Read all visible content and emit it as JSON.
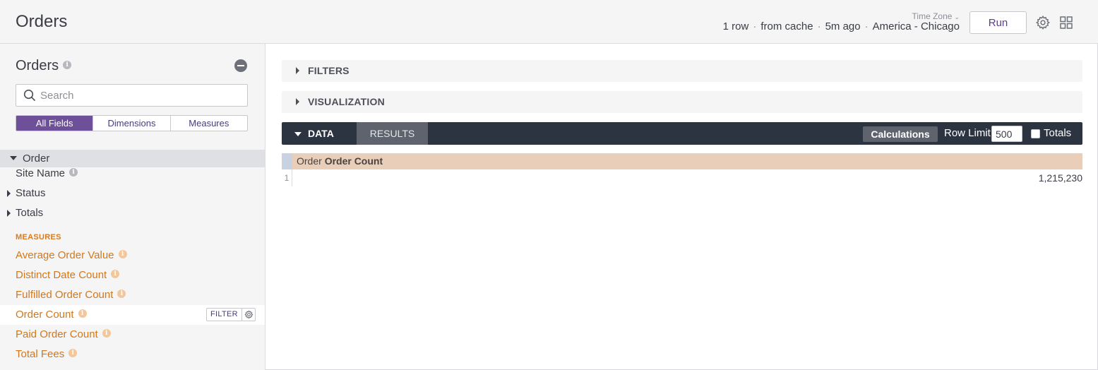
{
  "header": {
    "title": "Orders",
    "time_zone_label": "Time Zone",
    "meta": [
      "1 row",
      "from cache",
      "5m ago",
      "America - Chicago"
    ],
    "run_label": "Run"
  },
  "sidebar": {
    "explore_title": "Orders",
    "search_placeholder": "Search",
    "tabs": [
      "All Fields",
      "Dimensions",
      "Measures"
    ],
    "active_tab": "All Fields",
    "view_label": "Order",
    "dimensions": [
      {
        "label": "Site Name",
        "has_info": true
      },
      {
        "label": "Status",
        "expandable": true
      },
      {
        "label": "Totals",
        "expandable": true
      }
    ],
    "measures_heading": "MEASURES",
    "measures": [
      {
        "label": "Average Order Value"
      },
      {
        "label": "Distinct Date Count"
      },
      {
        "label": "Fulfilled Order Count"
      },
      {
        "label": "Order Count",
        "hovered": true
      },
      {
        "label": "Paid Order Count"
      },
      {
        "label": "Total Fees"
      }
    ],
    "filter_label": "FILTER"
  },
  "main": {
    "filters_label": "FILTERS",
    "visualization_label": "VISUALIZATION",
    "data_tab_label": "DATA",
    "results_tab_label": "RESULTS",
    "calculations_label": "Calculations",
    "row_limit_label": "Row Limit",
    "row_limit_value": "500",
    "totals_label": "Totals",
    "table": {
      "column_view": "Order",
      "column_field": "Order Count",
      "rows": [
        {
          "index": "1",
          "value": "1,215,230"
        }
      ]
    }
  },
  "colors": {
    "accent_purple": "#6d4f9a",
    "measure_orange": "#d2771c",
    "data_bar": "#2c3442",
    "header_cell": "#e9ceb9"
  }
}
